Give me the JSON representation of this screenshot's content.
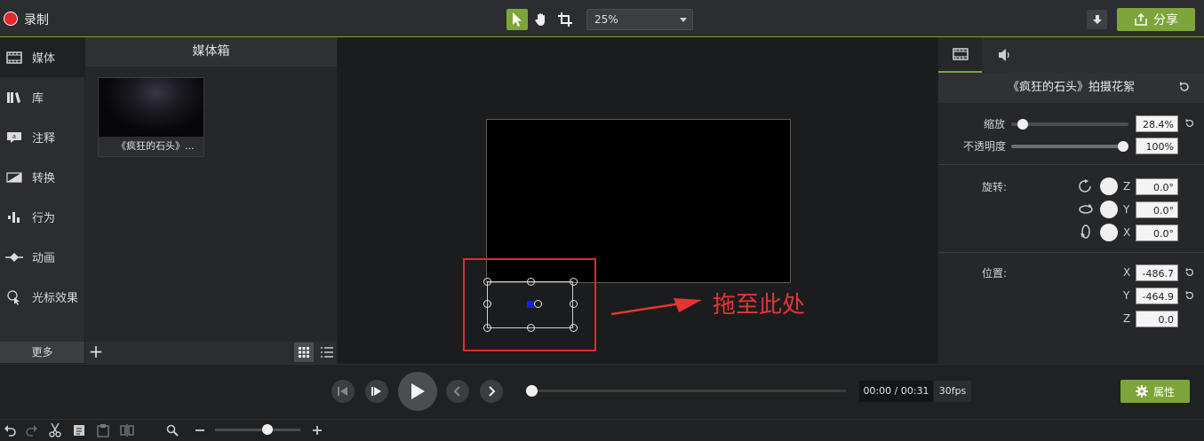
{
  "toolbar": {
    "record_label": "录制",
    "zoom_value": "25%",
    "share_label": "分享"
  },
  "left_nav": {
    "items": [
      {
        "label": "媒体",
        "icon": "film-icon"
      },
      {
        "label": "库",
        "icon": "library-icon"
      },
      {
        "label": "注释",
        "icon": "annotation-icon"
      },
      {
        "label": "转换",
        "icon": "transition-icon"
      },
      {
        "label": "行为",
        "icon": "behavior-icon"
      },
      {
        "label": "动画",
        "icon": "animation-icon"
      },
      {
        "label": "光标效果",
        "icon": "cursor-effect-icon"
      }
    ],
    "more_label": "更多"
  },
  "media_bin": {
    "title": "媒体箱",
    "clip_caption": "《疯狂的石头》..."
  },
  "canvas": {
    "drag_note": "拖至此处"
  },
  "properties": {
    "clip_title": "《疯狂的石头》拍摄花絮",
    "scale_label": "缩放",
    "scale_value": "28.4%",
    "scale_level": 0.1,
    "opacity_label": "不透明度",
    "opacity_value": "100%",
    "opacity_level": 1.0,
    "rotation_label": "旋转:",
    "rotation": [
      {
        "axis": "Z",
        "value": "0.0°"
      },
      {
        "axis": "Y",
        "value": "0.0°"
      },
      {
        "axis": "X",
        "value": "0.0°"
      }
    ],
    "position_label": "位置:",
    "position": [
      {
        "axis": "X",
        "value": "-486.7"
      },
      {
        "axis": "Y",
        "value": "-464.9"
      },
      {
        "axis": "Z",
        "value": "0.0"
      }
    ]
  },
  "playback": {
    "time": "00:00 / 00:31",
    "fps": "30fps",
    "properties_label": "属性"
  },
  "colors": {
    "accent": "#7da53a",
    "record": "#e0292b",
    "highlight": "#e02a2a"
  }
}
